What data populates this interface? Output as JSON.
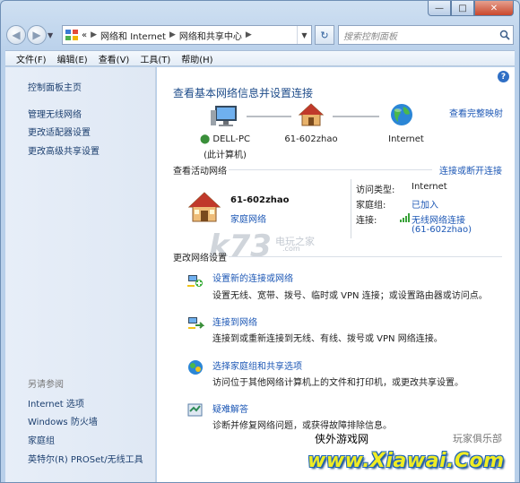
{
  "window": {
    "min_label": "—",
    "max_label": "□",
    "close_label": "✕"
  },
  "nav": {
    "back_glyph": "◀",
    "forward_glyph": "▶",
    "breadcrumbs": [
      "«",
      "网络和 Internet",
      "网络和共享中心"
    ],
    "refresh_glyph": "↻",
    "search_placeholder": "搜索控制面板"
  },
  "menu": [
    "文件(F)",
    "编辑(E)",
    "查看(V)",
    "工具(T)",
    "帮助(H)"
  ],
  "sidebar": {
    "items": [
      "控制面板主页",
      "管理无线网络",
      "更改适配器设置",
      "更改高级共享设置"
    ],
    "see_also_title": "另请参阅",
    "see_also": [
      "Internet 选项",
      "Windows 防火墙",
      "家庭组",
      "英特尔(R) PROSet/无线工具"
    ]
  },
  "main": {
    "title": "查看基本网络信息并设置连接",
    "see_full_map": "查看完整映射",
    "netmap": {
      "computer_name": "DELL-PC",
      "computer_note": "(此计算机)",
      "network_name": "61-602zhao",
      "internet": "Internet"
    },
    "active_section": "查看活动网络",
    "connect_disconnect": "连接或断开连接",
    "active_network": {
      "name": "61-602zhao",
      "type": "家庭网络",
      "access_key": "访问类型:",
      "access_val": "Internet",
      "homegroup_key": "家庭组:",
      "homegroup_val": "已加入",
      "connection_key": "连接:",
      "connection_val1": "无线网络连接",
      "connection_val2": "(61-602zhao)"
    },
    "change_section": "更改网络设置",
    "tasks": [
      {
        "title": "设置新的连接或网络",
        "desc": "设置无线、宽带、拨号、临时或 VPN 连接；或设置路由器或访问点。"
      },
      {
        "title": "连接到网络",
        "desc": "连接到或重新连接到无线、有线、拨号或 VPN 网络连接。"
      },
      {
        "title": "选择家庭组和共享选项",
        "desc": "访问位于其他网络计算机上的文件和打印机，或更改共享设置。"
      },
      {
        "title": "疑难解答",
        "desc": "诊断并修复网络问题，或获得故障排除信息。"
      }
    ]
  },
  "watermarks": {
    "k73": "k73",
    "k73_sub": "电玩之家",
    "k73_sub2": ".com",
    "site_cn": "侠外游戏网",
    "club": "玩家俱乐部",
    "logo": "www.Xiawai.Com"
  },
  "colors": {
    "link": "#1c57b5",
    "title": "#1e4c8a",
    "sidebar_bg": "#e3ebf6"
  }
}
